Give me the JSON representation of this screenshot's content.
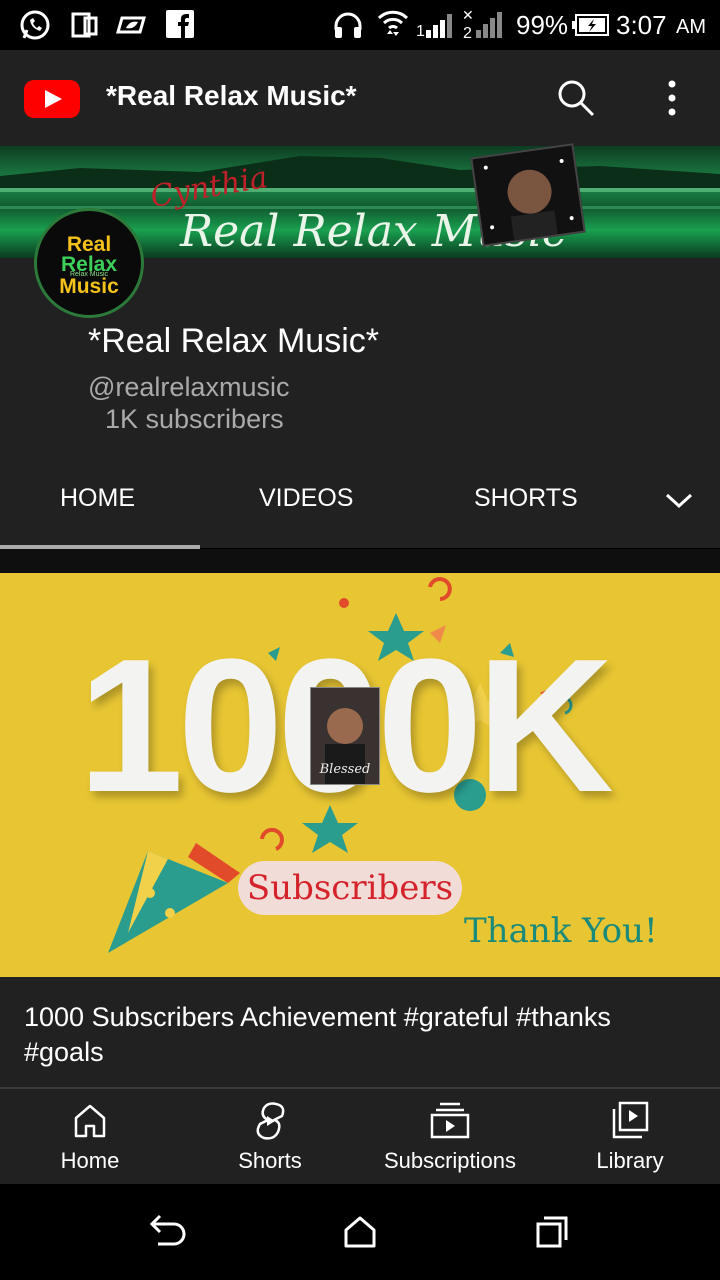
{
  "status_bar": {
    "battery": "99%",
    "time": "3:07",
    "ampm": "AM",
    "icons": [
      "whatsapp-icon",
      "book-icon",
      "leaf-icon",
      "facebook-icon",
      "headphones-icon",
      "wifi-icon",
      "signal-1-icon",
      "signal-2-icon",
      "battery-icon"
    ]
  },
  "app_bar": {
    "title": "*Real Relax Music*",
    "logo": "youtube-logo",
    "actions": [
      "search-icon",
      "more-vertical-icon"
    ]
  },
  "banner": {
    "script_text": "Real Relax Music",
    "corner_text": "Cynthia",
    "colors": {
      "green": "#1f8a4a"
    }
  },
  "avatar": {
    "line1": "Real",
    "line2": "Relax",
    "small": "Relax Music",
    "line3": "Music"
  },
  "channel": {
    "name": "*Real Relax Music*",
    "handle": "@realrelaxmusic",
    "subscribers": "1K subscribers"
  },
  "tabs": [
    {
      "label": "HOME",
      "active": true
    },
    {
      "label": "VIDEOS",
      "active": false
    },
    {
      "label": "SHORTS",
      "active": false
    }
  ],
  "video": {
    "thumb": {
      "big": "1000K",
      "badge": "Subscribers",
      "thanks": "Thank You!",
      "photo_caption": "Blessed",
      "bg": "#e7c533"
    },
    "title": "1000 Subscribers Achievement #grateful #thanks #goals"
  },
  "bottom_nav": [
    {
      "label": "Home",
      "icon": "home-icon"
    },
    {
      "label": "Shorts",
      "icon": "shorts-icon"
    },
    {
      "label": "Subscriptions",
      "icon": "subscriptions-icon"
    },
    {
      "label": "Library",
      "icon": "library-icon"
    }
  ],
  "system_nav": [
    "back-icon",
    "home-outline-icon",
    "recents-icon"
  ]
}
